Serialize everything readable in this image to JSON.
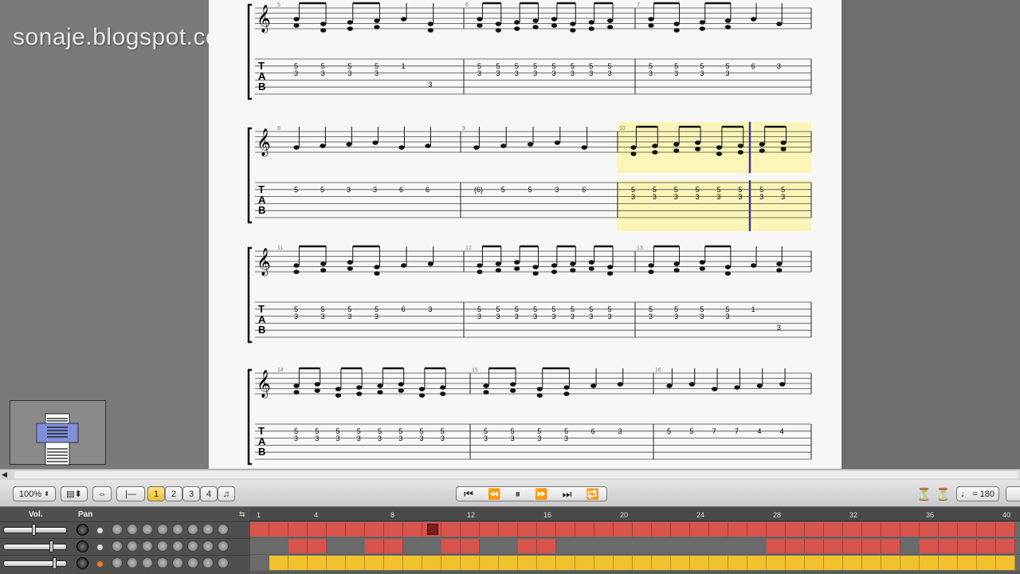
{
  "watermark": "sonaje.blogspot.com",
  "toolbar": {
    "zoom": "100%",
    "beat_buttons": [
      "1",
      "2",
      "3",
      "4"
    ],
    "tempo": "= 180"
  },
  "tracks": {
    "vol_label": "Vol.",
    "pan_label": "Pan",
    "ruler_numbers": [
      "1",
      "4",
      "8",
      "12",
      "16",
      "20",
      "24",
      "28",
      "32",
      "36",
      "40"
    ]
  },
  "score": {
    "systems": [
      {
        "measures": [
          {
            "number": "5",
            "tab": [
              [
                "5",
                "3"
              ],
              [
                "5",
                "3"
              ],
              [
                "5",
                "3"
              ],
              [
                "5",
                "3"
              ],
              [
                "1",
                ""
              ],
              [
                "",
                "3"
              ]
            ]
          },
          {
            "number": "6",
            "tab": [
              [
                "5",
                "3"
              ],
              [
                "5",
                "3"
              ],
              [
                "5",
                "3"
              ],
              [
                "5",
                "3"
              ],
              [
                "5",
                "3"
              ],
              [
                "5",
                "3"
              ],
              [
                "5",
                "3"
              ],
              [
                "5",
                "3"
              ]
            ]
          },
          {
            "number": "7",
            "tab": [
              [
                "5",
                "3"
              ],
              [
                "5",
                "3"
              ],
              [
                "5",
                "3"
              ],
              [
                "5",
                "3"
              ],
              [
                "6",
                ""
              ],
              [
                "3",
                ""
              ]
            ]
          }
        ]
      },
      {
        "measures": [
          {
            "number": "8",
            "tab": [
              "5",
              "5",
              "3",
              "3",
              "6",
              "6"
            ]
          },
          {
            "number": "9",
            "tab": [
              "(6)",
              "5",
              "5",
              "3",
              "6"
            ]
          },
          {
            "number": "10",
            "tab": [
              [
                "5",
                "3"
              ],
              [
                "5",
                "3"
              ],
              [
                "5",
                "3"
              ],
              [
                "5",
                "3"
              ],
              [
                "5",
                "3"
              ],
              [
                "5",
                "3"
              ],
              [
                "5",
                "3"
              ],
              [
                "5",
                "3"
              ]
            ]
          }
        ]
      },
      {
        "measures": [
          {
            "number": "11",
            "tab": [
              [
                "5",
                "3"
              ],
              [
                "5",
                "3"
              ],
              [
                "5",
                "3"
              ],
              [
                "5",
                "3"
              ],
              [
                "6",
                ""
              ],
              [
                "3",
                ""
              ]
            ]
          },
          {
            "number": "12",
            "tab": [
              [
                "5",
                "3"
              ],
              [
                "5",
                "3"
              ],
              [
                "5",
                "3"
              ],
              [
                "5",
                "3"
              ],
              [
                "5",
                "3"
              ],
              [
                "5",
                "3"
              ],
              [
                "5",
                "3"
              ],
              [
                "5",
                "3"
              ]
            ]
          },
          {
            "number": "13",
            "tab": [
              [
                "5",
                "3"
              ],
              [
                "5",
                "3"
              ],
              [
                "5",
                "3"
              ],
              [
                "5",
                "3"
              ],
              [
                "1",
                ""
              ],
              [
                "",
                "3"
              ]
            ]
          }
        ]
      },
      {
        "measures": [
          {
            "number": "14",
            "tab": [
              [
                "5",
                "3"
              ],
              [
                "5",
                "3"
              ],
              [
                "5",
                "3"
              ],
              [
                "5",
                "3"
              ],
              [
                "5",
                "3"
              ],
              [
                "5",
                "3"
              ],
              [
                "5",
                "3"
              ],
              [
                "5",
                "3"
              ]
            ]
          },
          {
            "number": "15",
            "tab": [
              [
                "5",
                "3"
              ],
              [
                "5",
                "3"
              ],
              [
                "5",
                "3"
              ],
              [
                "5",
                "3"
              ],
              [
                "6",
                ""
              ],
              [
                "3",
                ""
              ]
            ]
          },
          {
            "number": "16",
            "tab": [
              "5",
              "5",
              "7",
              "7",
              "4",
              "4"
            ]
          }
        ]
      }
    ],
    "tab_letters": [
      "T",
      "A",
      "B"
    ]
  },
  "colors": {
    "highlight": "#fbf6b8",
    "cursor": "#3a3a9a",
    "lane_red": "#d8544c",
    "lane_yellow": "#f2c12e"
  }
}
